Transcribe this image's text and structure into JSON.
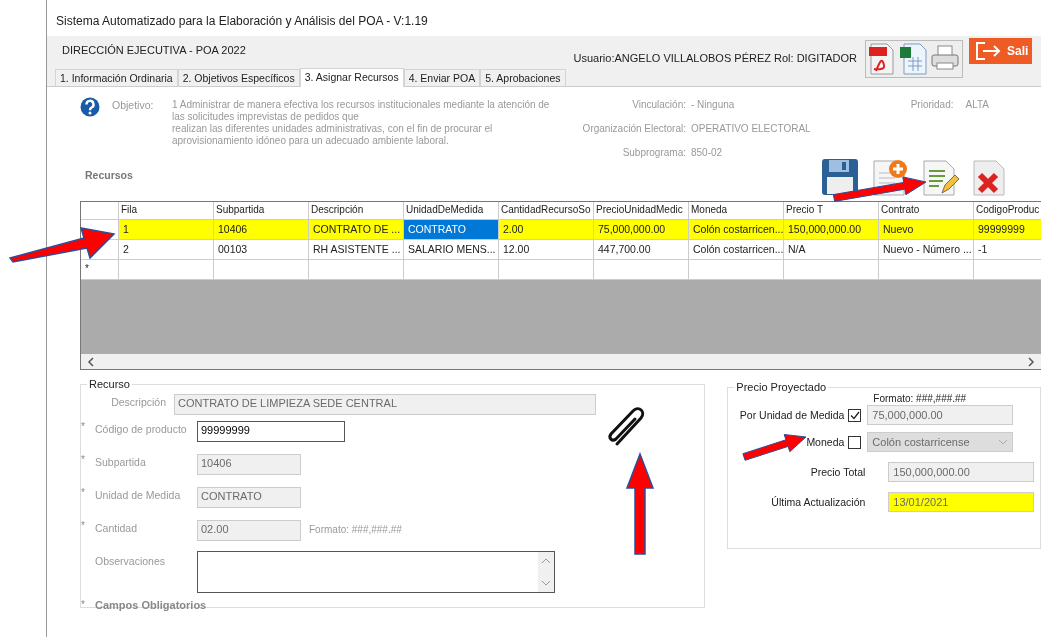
{
  "window": {
    "title": "Sistema Automatizado para la Elaboración y Análisis del POA -  V:1.19"
  },
  "header": {
    "section": "DIRECCIÓN EJECUTIVA - POA 2022",
    "user": "Usuario:ANGELO VILLALOBOS PÉREZ  Rol: DIGITADOR",
    "exit_button": "Sali"
  },
  "tabs": [
    {
      "label": "1. Información Ordinaria",
      "selected": false
    },
    {
      "label": "2. Objetivos Específicos",
      "selected": false
    },
    {
      "label": "3. Asignar Recursos",
      "selected": true
    },
    {
      "label": "4. Enviar POA",
      "selected": false
    },
    {
      "label": "5. Aprobaciones",
      "selected": false
    }
  ],
  "objective": {
    "label": "Objetivo:",
    "lines": [
      "1 Administrar de manera efectiva los recursos institucionales mediante la atención de",
      "las solicitudes imprevistas de pedidos que",
      "realizan las diferentes unidades administrativas, con el fin de procurar el",
      "aprovisionamiento idóneo para un adecuado ambiente laboral."
    ]
  },
  "info": [
    {
      "label": "Vinculación:",
      "value": "- Ninguna"
    },
    {
      "label": "Organización Electoral:",
      "value": "OPERATIVO ELECTORAL"
    },
    {
      "label": "Subprograma:",
      "value": "850-02"
    }
  ],
  "priority": {
    "label": "Prioridad:",
    "value": "ALTA"
  },
  "recursos_label": "Recursos",
  "table": {
    "columns": [
      "Fila",
      "Subpartida",
      "Descripción",
      "UnidadDeMedida",
      "CantidadRecursoSo",
      "PrecioUnidadMedic",
      "Moneda",
      "Precio T",
      "Contrato",
      "CodigoProduc"
    ],
    "rows": [
      {
        "selected": true,
        "cells": [
          {
            "text": "1",
            "selected": false
          },
          {
            "text": "10406",
            "selected": false
          },
          {
            "text": "CONTRATO DE ...",
            "selected": false
          },
          {
            "text": "CONTRATO",
            "selected": true
          },
          {
            "text": "2.00",
            "selected": false
          },
          {
            "text": "75,000,000.00",
            "selected": false
          },
          {
            "text": "Colón costarricen...",
            "selected": false
          },
          {
            "text": "150,000,000.00",
            "selected": false
          },
          {
            "text": "Nuevo",
            "selected": false
          },
          {
            "text": "99999999",
            "selected": false
          }
        ]
      },
      {
        "selected": false,
        "cells": [
          {
            "text": "2",
            "selected": false
          },
          {
            "text": "00103",
            "selected": false
          },
          {
            "text": "RH ASISTENTE ...",
            "selected": false
          },
          {
            "text": "SALARIO MENS...",
            "selected": false
          },
          {
            "text": "12.00",
            "selected": false
          },
          {
            "text": "447,700.00",
            "selected": false
          },
          {
            "text": "Colón costarricen...",
            "selected": false
          },
          {
            "text": "N/A",
            "selected": false
          },
          {
            "text": "Nuevo - Número ...",
            "selected": false
          },
          {
            "text": "-1",
            "selected": false
          }
        ]
      }
    ],
    "new_row_marker": "*"
  },
  "recurso": {
    "title": "Recurso",
    "fields": [
      {
        "kind": "text",
        "label": "Descripción",
        "value": "CONTRATO DE LIMPIEZA SEDE CENTRAL",
        "disabled": true
      },
      {
        "kind": "text",
        "mark": "*",
        "label": "Código de producto",
        "value": "99999999",
        "disabled": false
      },
      {
        "kind": "text",
        "mark": "*",
        "label": "Subpartida",
        "value": "10406",
        "disabled": true
      },
      {
        "kind": "text",
        "mark": "*",
        "label": "Unidad de Medida",
        "value": "CONTRATO",
        "disabled": true
      },
      {
        "kind": "text",
        "mark": "*",
        "label": "Cantidad",
        "value": "02.00",
        "disabled": true,
        "hint": "Formato: ###,###.##"
      },
      {
        "kind": "area",
        "label": "Observaciones",
        "disabled": false
      }
    ],
    "footer_mark": "*",
    "footer": "Campos Obligatorios"
  },
  "precio": {
    "title": "Precio Proyectado",
    "format": "Formato: ###,###.##",
    "rows": [
      {
        "kind": "check",
        "label": "Por Unidad de Medida",
        "checked": true,
        "value": "75,000,000.00"
      },
      {
        "kind": "select",
        "label": "Moneda",
        "checked": false,
        "value": "Colón costarricense"
      },
      {
        "kind": "text",
        "label": "Precio Total",
        "value": "150,000,000.00",
        "highlighted": false
      },
      {
        "kind": "text",
        "label": "Última Actualización",
        "value": "13/01/2021",
        "highlighted": true
      }
    ]
  }
}
